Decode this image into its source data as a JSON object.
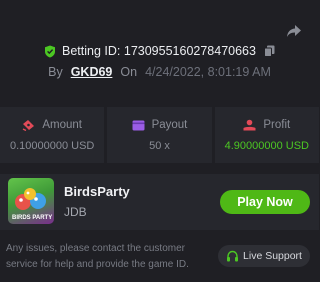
{
  "header": {
    "betting_label": "Betting ID:",
    "betting_id": "1730955160278470663",
    "by_label": "By",
    "username": "GKD69",
    "on_label": "On",
    "datetime": "4/24/2022, 8:01:19 AM",
    "icons": {
      "share": "share-icon",
      "verified": "shield-check-icon",
      "copy": "copy-icon"
    }
  },
  "stats": [
    {
      "label": "Amount",
      "value": "0.10000000 USD",
      "icon": "amount-icon"
    },
    {
      "label": "Payout",
      "value": "50 x",
      "icon": "wallet-icon"
    },
    {
      "label": "Profit",
      "value": "4.90000000 USD",
      "icon": "profit-icon"
    }
  ],
  "game": {
    "title": "BirdsParty",
    "provider": "JDB",
    "play_label": "Play Now",
    "thumb_text": "BIRDS PARTY"
  },
  "support": {
    "text": "Any issues, please contact the customer service for help and provide the game ID.",
    "button_label": "Live Support"
  },
  "colors": {
    "background": "#1f1f24",
    "panel": "#26272d",
    "accent_green": "#4fb816",
    "profit_green": "#4cc723",
    "red_icon": "#e24a58",
    "purple_icon": "#9b5de5"
  }
}
